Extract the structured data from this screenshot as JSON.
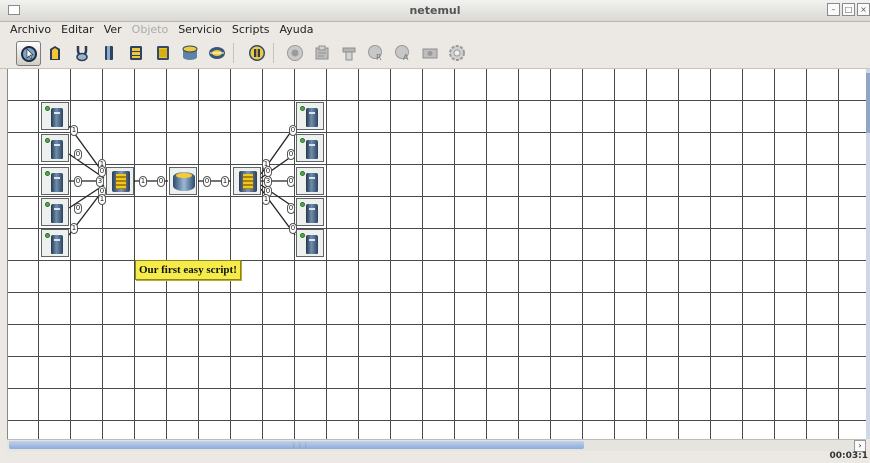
{
  "window": {
    "title": "netemul"
  },
  "menu": [
    {
      "label": "Archivo",
      "enabled": true
    },
    {
      "label": "Editar",
      "enabled": true
    },
    {
      "label": "Ver",
      "enabled": true
    },
    {
      "label": "Objeto",
      "enabled": false
    },
    {
      "label": "Servicio",
      "enabled": true
    },
    {
      "label": "Scripts",
      "enabled": true
    },
    {
      "label": "Ayuda",
      "enabled": true
    }
  ],
  "toolbar": [
    {
      "name": "select-tool-icon",
      "active": true
    },
    {
      "name": "text-note-icon",
      "active": false
    },
    {
      "name": "cable-tool-icon",
      "active": false
    },
    {
      "name": "computer-icon",
      "active": false
    },
    {
      "name": "hub-icon",
      "active": false
    },
    {
      "name": "switch-icon",
      "active": false
    },
    {
      "name": "router-icon",
      "active": false
    },
    {
      "name": "network-icon",
      "active": false
    },
    {
      "name": "pause-icon",
      "active": false
    },
    {
      "name": "record-icon",
      "active": false
    },
    {
      "name": "properties-icon",
      "active": false
    },
    {
      "name": "print-icon",
      "active": false
    },
    {
      "name": "routing-table-icon",
      "active": false
    },
    {
      "name": "arp-table-icon",
      "active": false
    },
    {
      "name": "screenshot-icon",
      "active": false
    },
    {
      "name": "settings-gear-icon",
      "active": false
    }
  ],
  "canvas": {
    "note": "Our first easy script!",
    "port_labels": {
      "left_pc": [
        "1",
        "0",
        "0",
        "0",
        "1"
      ],
      "left_switch": [
        "1",
        "0",
        "3",
        "0",
        "1"
      ],
      "center_links": [
        "1",
        "0",
        "0",
        "1"
      ],
      "right_switch": [
        "1",
        "0",
        "3",
        "0",
        "1"
      ],
      "right_pc": [
        "0",
        "0",
        "0",
        "0",
        "0"
      ]
    }
  },
  "status": {
    "clock": "00:03:1"
  },
  "colors": {
    "grid": "#4a4a4a",
    "note_bg": "#f5eb4a",
    "scroll_thumb": "#8eabd6",
    "led": "#4caf3f"
  }
}
